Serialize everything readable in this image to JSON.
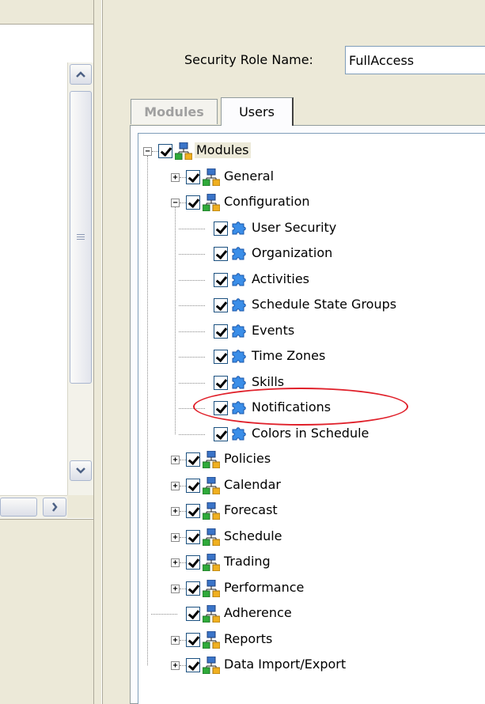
{
  "security_role": {
    "label": "Security Role Name:",
    "value": "FullAccess"
  },
  "tabs": [
    {
      "label": "Modules",
      "active": true
    },
    {
      "label": "Users",
      "active": false
    }
  ],
  "tree": {
    "root": {
      "label": "Modules",
      "checked": true,
      "expanded": true,
      "icon": "module-group-icon"
    },
    "items": [
      {
        "label": "General",
        "checked": true,
        "expandable": true,
        "expanded": false
      },
      {
        "label": "Configuration",
        "checked": true,
        "expandable": true,
        "expanded": true,
        "children": [
          {
            "label": "User Security",
            "checked": true,
            "icon": "puzzle-icon"
          },
          {
            "label": "Organization",
            "checked": true,
            "icon": "puzzle-icon"
          },
          {
            "label": "Activities",
            "checked": true,
            "icon": "puzzle-icon"
          },
          {
            "label": "Schedule State Groups",
            "checked": true,
            "icon": "puzzle-icon"
          },
          {
            "label": "Events",
            "checked": true,
            "icon": "puzzle-icon"
          },
          {
            "label": "Time Zones",
            "checked": true,
            "icon": "puzzle-icon"
          },
          {
            "label": "Skills",
            "checked": true,
            "icon": "puzzle-icon"
          },
          {
            "label": "Notifications",
            "checked": true,
            "icon": "puzzle-icon",
            "highlighted": true
          },
          {
            "label": "Colors in Schedule",
            "checked": true,
            "icon": "puzzle-icon"
          }
        ]
      },
      {
        "label": "Policies",
        "checked": true,
        "expandable": true,
        "expanded": false
      },
      {
        "label": "Calendar",
        "checked": true,
        "expandable": true,
        "expanded": false
      },
      {
        "label": "Forecast",
        "checked": true,
        "expandable": true,
        "expanded": false
      },
      {
        "label": "Schedule",
        "checked": true,
        "expandable": true,
        "expanded": false
      },
      {
        "label": "Trading",
        "checked": true,
        "expandable": true,
        "expanded": false
      },
      {
        "label": "Performance",
        "checked": true,
        "expandable": true,
        "expanded": false
      },
      {
        "label": "Adherence",
        "checked": true,
        "expandable": false,
        "expanded": false
      },
      {
        "label": "Reports",
        "checked": true,
        "expandable": true,
        "expanded": false
      },
      {
        "label": "Data Import/Export",
        "checked": true,
        "expandable": true,
        "expanded": false
      }
    ]
  },
  "colors": {
    "annotation": "#e0202a",
    "window_bg": "#ece9d8",
    "checkbox_border": "#1c5180"
  }
}
